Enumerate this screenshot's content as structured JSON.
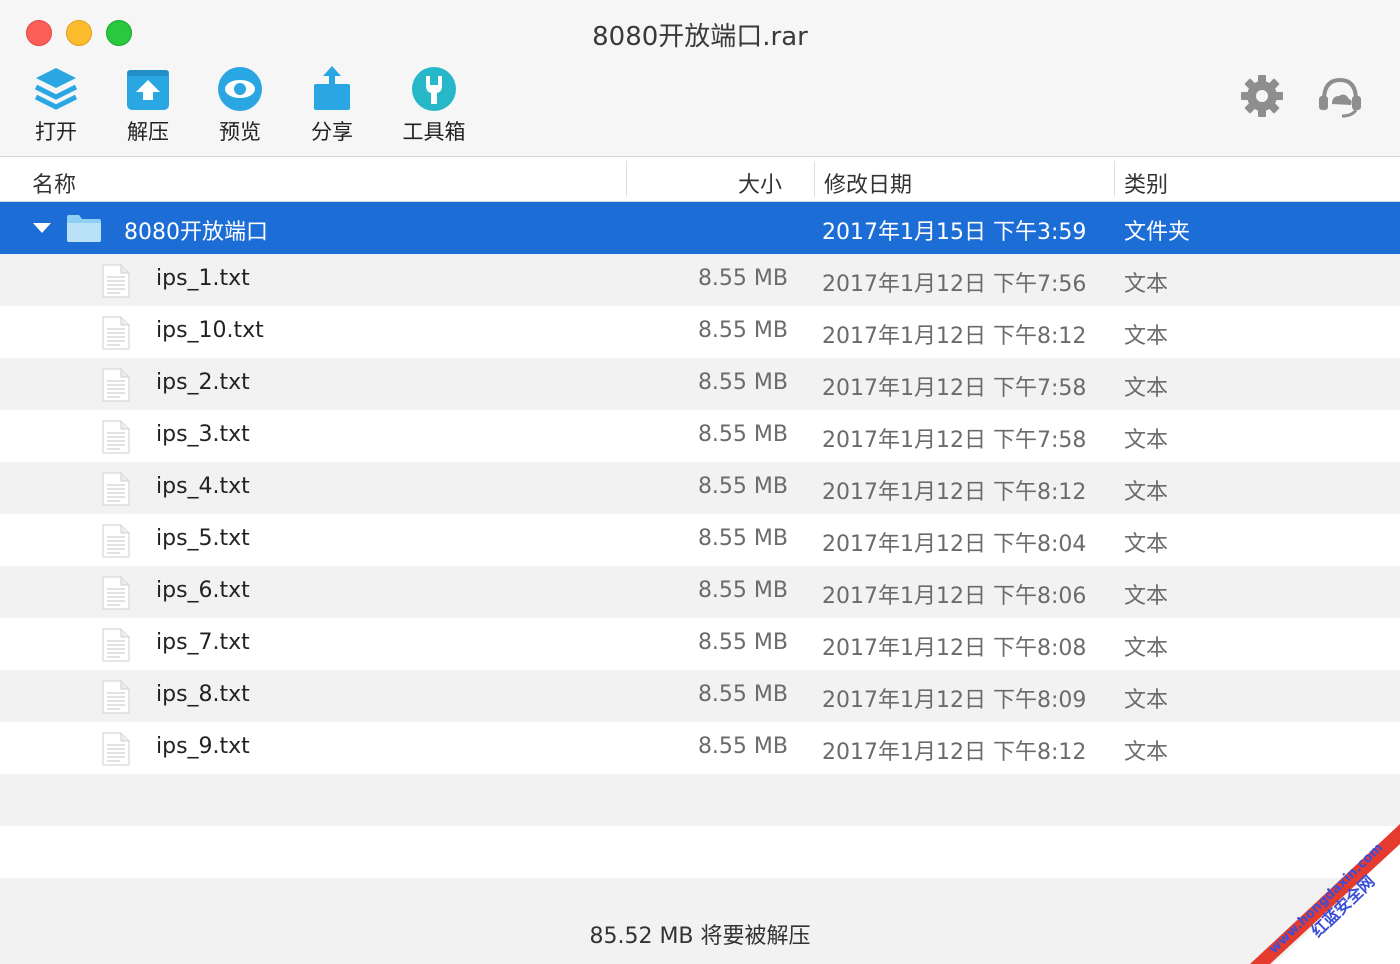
{
  "window": {
    "title": "8080开放端口.rar"
  },
  "toolbar": {
    "open_label": "打开",
    "extract_label": "解压",
    "preview_label": "预览",
    "share_label": "分享",
    "toolbox_label": "工具箱"
  },
  "columns": {
    "name": "名称",
    "size": "大小",
    "modified": "修改日期",
    "kind": "类别"
  },
  "folder": {
    "name": "8080开放端口",
    "modified": "2017年1月15日 下午3:59",
    "kind": "文件夹"
  },
  "files": [
    {
      "name": "ips_1.txt",
      "size": "8.55 MB",
      "modified": "2017年1月12日 下午7:56",
      "kind": "文本"
    },
    {
      "name": "ips_10.txt",
      "size": "8.55 MB",
      "modified": "2017年1月12日 下午8:12",
      "kind": "文本"
    },
    {
      "name": "ips_2.txt",
      "size": "8.55 MB",
      "modified": "2017年1月12日 下午7:58",
      "kind": "文本"
    },
    {
      "name": "ips_3.txt",
      "size": "8.55 MB",
      "modified": "2017年1月12日 下午7:58",
      "kind": "文本"
    },
    {
      "name": "ips_4.txt",
      "size": "8.55 MB",
      "modified": "2017年1月12日 下午8:12",
      "kind": "文本"
    },
    {
      "name": "ips_5.txt",
      "size": "8.55 MB",
      "modified": "2017年1月12日 下午8:04",
      "kind": "文本"
    },
    {
      "name": "ips_6.txt",
      "size": "8.55 MB",
      "modified": "2017年1月12日 下午8:06",
      "kind": "文本"
    },
    {
      "name": "ips_7.txt",
      "size": "8.55 MB",
      "modified": "2017年1月12日 下午8:08",
      "kind": "文本"
    },
    {
      "name": "ips_8.txt",
      "size": "8.55 MB",
      "modified": "2017年1月12日 下午8:09",
      "kind": "文本"
    },
    {
      "name": "ips_9.txt",
      "size": "8.55 MB",
      "modified": "2017年1月12日 下午8:12",
      "kind": "文本"
    }
  ],
  "status": {
    "text": "85.52 MB 将要被解压"
  },
  "watermark": {
    "line1": "www.hongdaxin.com",
    "line2": "红蓝安全网"
  },
  "icons": {
    "open": "layers-stack-icon",
    "extract": "extract-tray-icon",
    "preview": "eye-icon",
    "share": "share-upload-icon",
    "toolbox": "wrench-icon",
    "settings": "gear-icon",
    "support": "headset-cloud-icon",
    "folder": "folder-icon",
    "file": "text-file-icon"
  },
  "colors": {
    "accent": "#29a6e0",
    "selection": "#1c6ed6",
    "row_alt": "#f2f2f2"
  }
}
